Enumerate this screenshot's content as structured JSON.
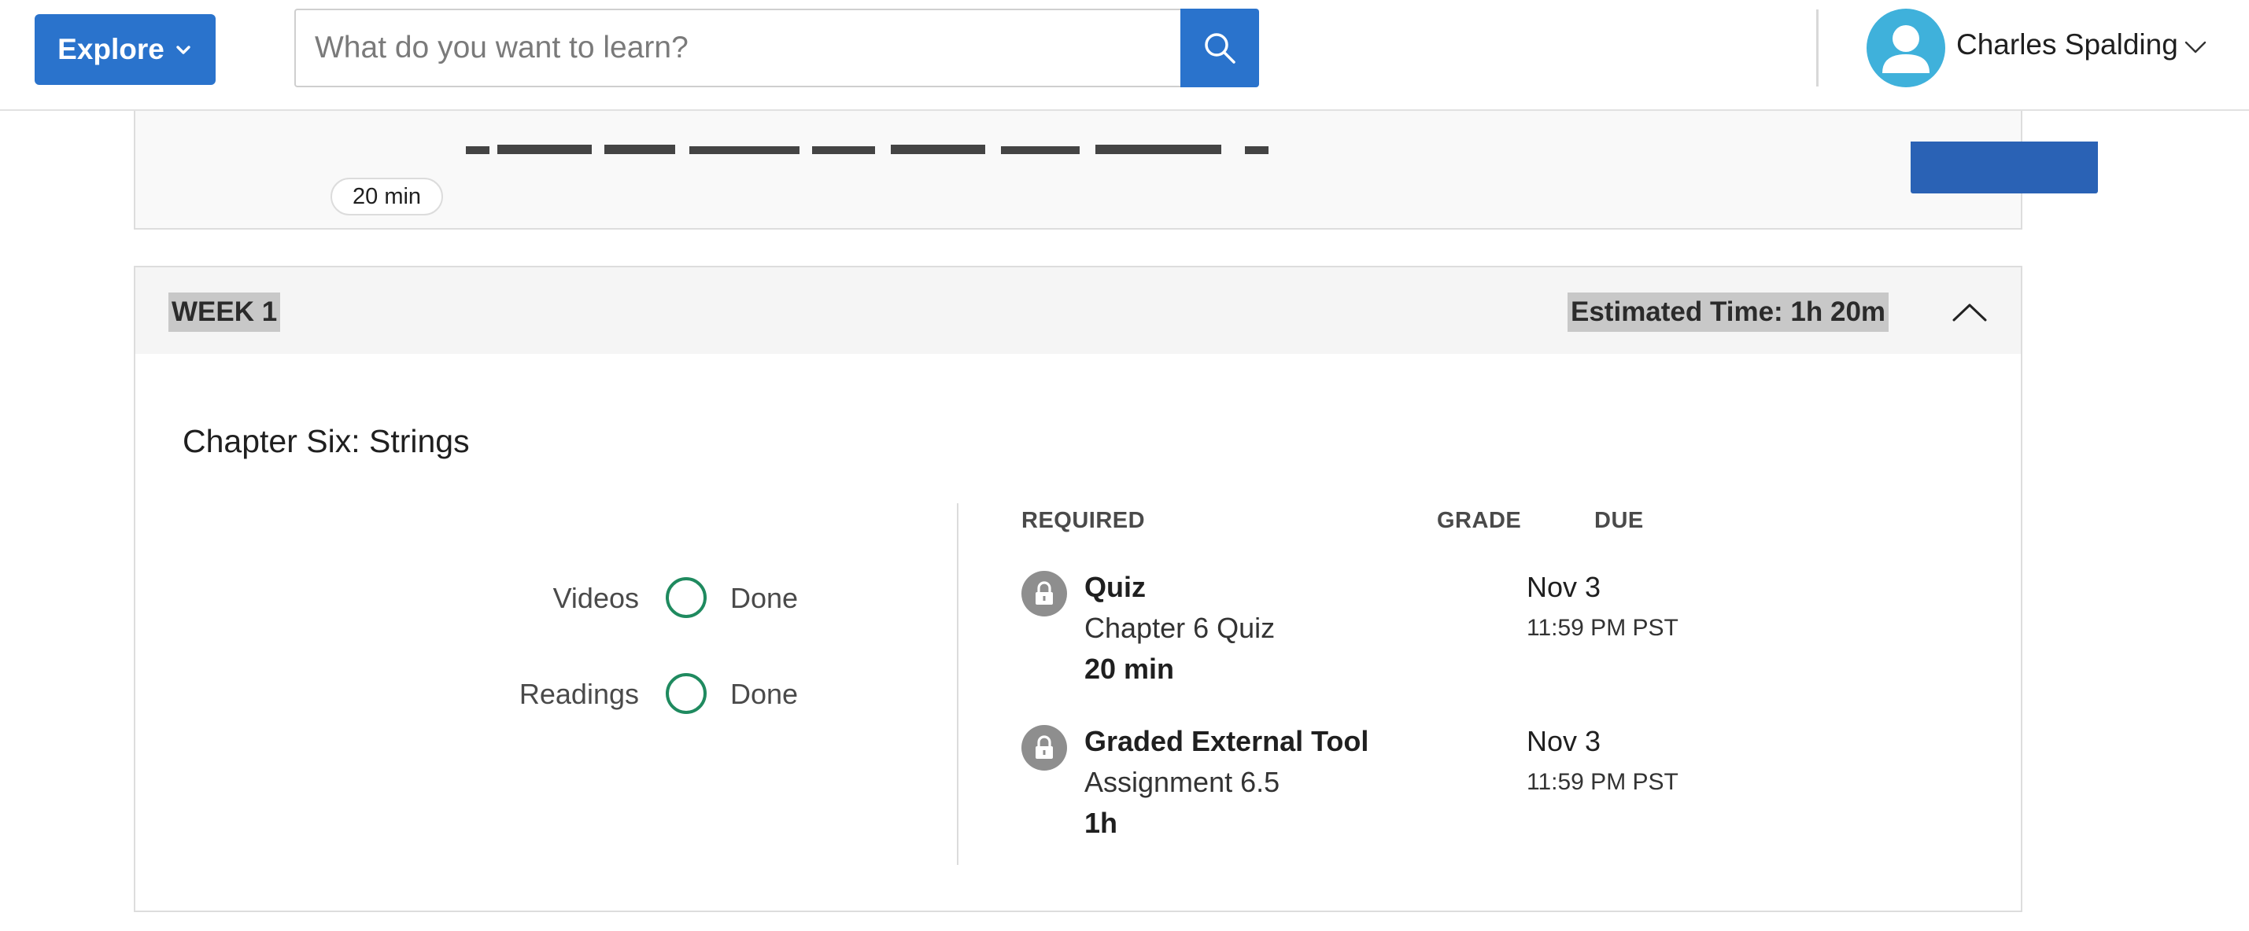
{
  "header": {
    "explore_label": "Explore",
    "search_placeholder": "What do you want to learn?",
    "user_name": "Charles Spalding"
  },
  "previous_item": {
    "duration": "20 min"
  },
  "week": {
    "label": "WEEK 1",
    "estimated_time": "Estimated Time: 1h 20m",
    "chapter_title": "Chapter Six: Strings",
    "progress": [
      {
        "label": "Videos",
        "status": "Done"
      },
      {
        "label": "Readings",
        "status": "Done"
      }
    ],
    "columns": {
      "required": "REQUIRED",
      "grade": "GRADE",
      "due": "DUE"
    },
    "items": [
      {
        "type": "Quiz",
        "name": "Chapter 6 Quiz",
        "duration": "20 min",
        "due_date": "Nov 3",
        "due_time": "11:59 PM PST"
      },
      {
        "type": "Graded External Tool",
        "name": "Assignment 6.5",
        "duration": "1h",
        "due_date": "Nov 3",
        "due_time": "11:59 PM PST"
      }
    ]
  },
  "colors": {
    "primary": "#2a73cc",
    "avatar": "#3fb1db",
    "progress_ring": "#1f8a5f",
    "lock_icon": "#8e8e8e"
  }
}
